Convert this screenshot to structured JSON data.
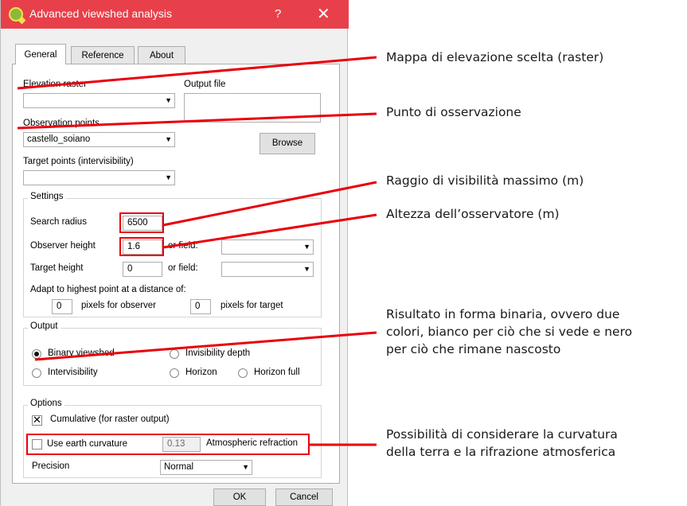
{
  "window": {
    "title": "Advanced viewshed analysis",
    "help": "?",
    "close": "✕"
  },
  "tabs": [
    {
      "label": "General",
      "active": true
    },
    {
      "label": "Reference",
      "active": false
    },
    {
      "label": "About",
      "active": false
    }
  ],
  "general": {
    "elevation_label": "Elevation raster",
    "elevation_value": "",
    "output_label": "Output file",
    "output_value": "",
    "observation_label": "Observation points",
    "observation_value": "castello_soiano",
    "browse_label": "Browse",
    "target_points_label": "Target points (intervisibility)",
    "target_points_value": ""
  },
  "settings": {
    "title": "Settings",
    "search_radius_label": "Search radius",
    "search_radius_value": "6500",
    "observer_height_label": "Observer height",
    "observer_height_value": "1.6",
    "or_field_label": "or field:",
    "target_height_label": "Target height",
    "target_height_value": "0",
    "adapt_label": "Adapt to highest point at a distance of:",
    "pixels_observer_value": "0",
    "pixels_observer_label": "pixels for observer",
    "pixels_target_value": "0",
    "pixels_target_label": "pixels for target"
  },
  "output": {
    "title": "Output",
    "options": [
      {
        "label": "Binary viewshed",
        "selected": true
      },
      {
        "label": "Invisibility depth",
        "selected": false
      },
      {
        "label": "Intervisibility",
        "selected": false
      },
      {
        "label": "Horizon",
        "selected": false
      },
      {
        "label": "Horizon full",
        "selected": false
      }
    ]
  },
  "options": {
    "title": "Options",
    "cumulative_label": "Cumulative (for raster output)",
    "cumulative_checked": true,
    "curvature_label": "Use earth curvature",
    "curvature_checked": false,
    "refraction_value": "0.13",
    "refraction_label": "Atmospheric refraction",
    "precision_label": "Precision",
    "precision_value": "Normal"
  },
  "buttons": {
    "ok": "OK",
    "cancel": "Cancel"
  },
  "annotations": {
    "elevation": "Mappa di elevazione scelta (raster)",
    "observation": "Punto di osservazione",
    "radius": "Raggio di visibilità massimo (m)",
    "height": "Altezza dell’osservatore (m)",
    "binary_line1": "Risultato in forma binaria, ovvero due",
    "binary_line2": "colori, bianco per ciò che si vede e nero",
    "binary_line3": "per ciò che rimane nascosto",
    "curvature_line1": "Possibilità di considerare la curvatura",
    "curvature_line2": "della terra e la rifrazione atmosferica"
  },
  "colors": {
    "titlebar": "#e8404a",
    "highlight": "#e8000b"
  }
}
